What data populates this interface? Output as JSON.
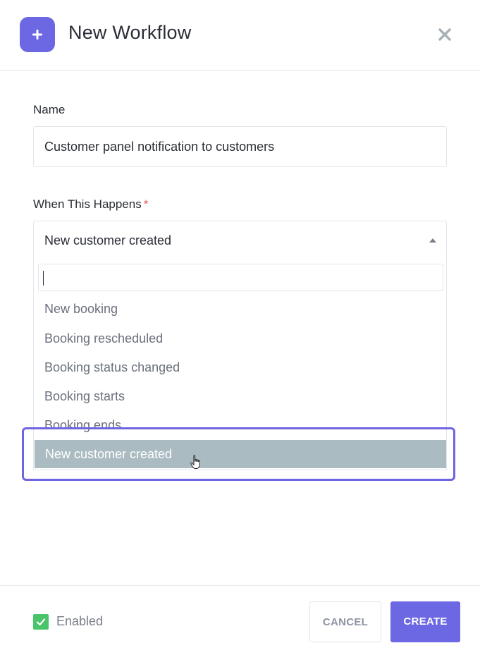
{
  "header": {
    "title": "New Workflow",
    "icon": "plus-icon",
    "close_icon": "close-icon"
  },
  "form": {
    "name": {
      "label": "Name",
      "value": "Customer panel notification to customers"
    },
    "trigger": {
      "label": "When This Happens",
      "required_mark": "*",
      "selected_value": "New customer created",
      "search_value": "",
      "options": [
        "New booking",
        "Booking rescheduled",
        "Booking status changed",
        "Booking starts",
        "Booking ends",
        "New customer created"
      ],
      "highlighted_option": "New customer created"
    }
  },
  "footer": {
    "enabled_label": "Enabled",
    "enabled_checked": true,
    "cancel_label": "CANCEL",
    "create_label": "CREATE"
  },
  "colors": {
    "accent": "#6c67e2",
    "check_green": "#4ac46b",
    "option_highlight": "#aabbc2",
    "required_red": "#e45757"
  }
}
